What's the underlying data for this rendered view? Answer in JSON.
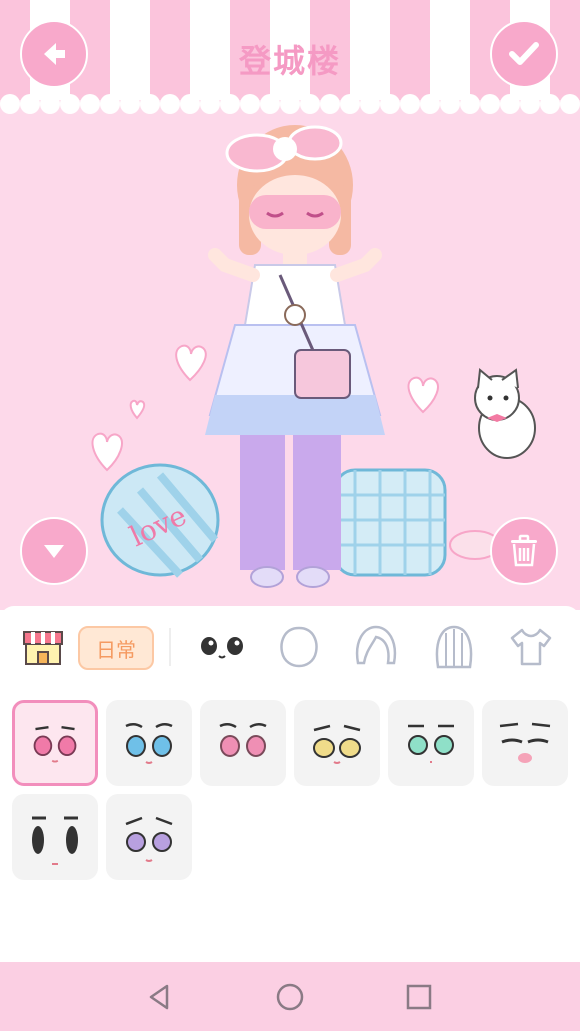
{
  "header": {
    "title": "登城楼"
  },
  "toolbar": {
    "category_label": "日常",
    "tabs": [
      {
        "name": "face-tab",
        "icon": "eyes-icon"
      },
      {
        "name": "head-tab",
        "icon": "head-icon"
      },
      {
        "name": "front-hair-tab",
        "icon": "front-hair-icon"
      },
      {
        "name": "back-hair-tab",
        "icon": "back-hair-icon"
      },
      {
        "name": "clothes-tab",
        "icon": "tshirt-icon"
      }
    ]
  },
  "face_options": [
    {
      "eye_color": "#f07aa8",
      "selected": true
    },
    {
      "eye_color": "#6fc0e8",
      "selected": false
    },
    {
      "eye_color": "#ef8fb4",
      "selected": false
    },
    {
      "eye_color": "#f0dc8a",
      "selected": false
    },
    {
      "eye_color": "#8fe0c8",
      "selected": false
    },
    {
      "eye_color": "#555555",
      "selected": false
    },
    {
      "eye_color": "#333333",
      "selected": false
    },
    {
      "eye_color": "#b8a0e0",
      "selected": false
    }
  ],
  "colors": {
    "accent": "#f8a9cb",
    "scene_bg": "#fdd9ea",
    "title": "#f59ac4",
    "navbar": "#fbcfe3"
  }
}
